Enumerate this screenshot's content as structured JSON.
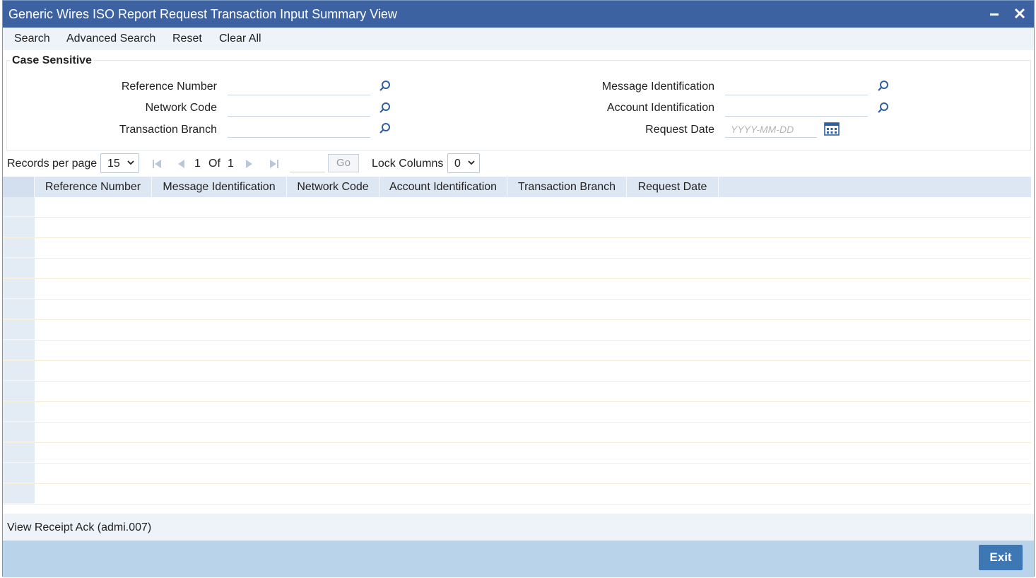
{
  "window": {
    "title": "Generic Wires ISO Report Request Transaction Input Summary View",
    "title_bar_color": "#3d62a1"
  },
  "toolbar": {
    "search_label": "Search",
    "advanced_search_label": "Advanced Search",
    "reset_label": "Reset",
    "clear_all_label": "Clear All"
  },
  "search_panel": {
    "case_sensitive_label": "Case Sensitive",
    "reference_number_label": "Reference Number",
    "network_code_label": "Network Code",
    "transaction_branch_label": "Transaction Branch",
    "message_identification_label": "Message Identification",
    "account_identification_label": "Account Identification",
    "request_date_label": "Request Date",
    "request_date_placeholder": "YYYY-MM-DD"
  },
  "pager": {
    "records_per_page_label": "Records per page",
    "records_per_page_value": "15",
    "current_page": "1",
    "of_label": "Of",
    "total_pages": "1",
    "go_label": "Go",
    "lock_columns_label": "Lock Columns",
    "lock_columns_value": "0"
  },
  "grid": {
    "columns": [
      "Reference Number",
      "Message Identification",
      "Network Code",
      "Account Identification",
      "Transaction Branch",
      "Request Date"
    ],
    "row_count": 15,
    "header_color": "#dde7f3"
  },
  "footer": {
    "view_receipt_link": "View Receipt Ack (admi.007)",
    "exit_label": "Exit",
    "exit_button_color": "#3d78b4"
  },
  "icons": [
    "minimize-icon",
    "close-icon",
    "search-icon",
    "calendar-icon",
    "first-page-icon",
    "prev-page-icon",
    "next-page-icon",
    "last-page-icon",
    "chevron-down-icon"
  ]
}
